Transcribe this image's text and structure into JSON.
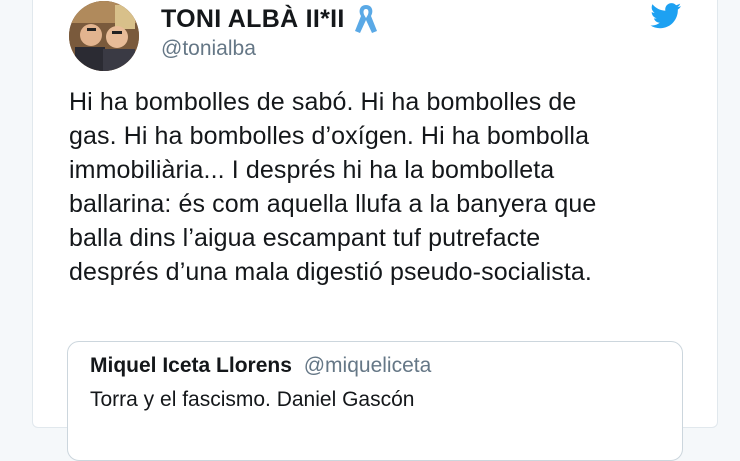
{
  "tweet": {
    "display_name": "TONI ALBÀ II*II",
    "handle": "@tonialba",
    "text_lines": [
      "Hi ha bombolles de sabó. Hi ha bombolles de",
      "gas. Hi ha bombolles d’oxígen. Hi ha bombolla",
      "immobiliària... I després hi ha la bombolleta",
      "ballarina: és com aquella llufa a la banyera que",
      "balla dins l’aigua escampant tuf putrefacte",
      "després d’una mala digestió pseudo-socialista."
    ]
  },
  "quoted_tweet": {
    "display_name": "Miquel Iceta Llorens",
    "handle": "@miqueliceta",
    "text": "Torra y el fascismo. Daniel Gascón"
  },
  "icons": {
    "ribbon": "blue-ribbon-icon",
    "bird": "twitter-bird-icon"
  },
  "colors": {
    "twitter_blue": "#1da1f2",
    "ribbon_blue": "#5aa9e6",
    "secondary_text": "#657786"
  }
}
